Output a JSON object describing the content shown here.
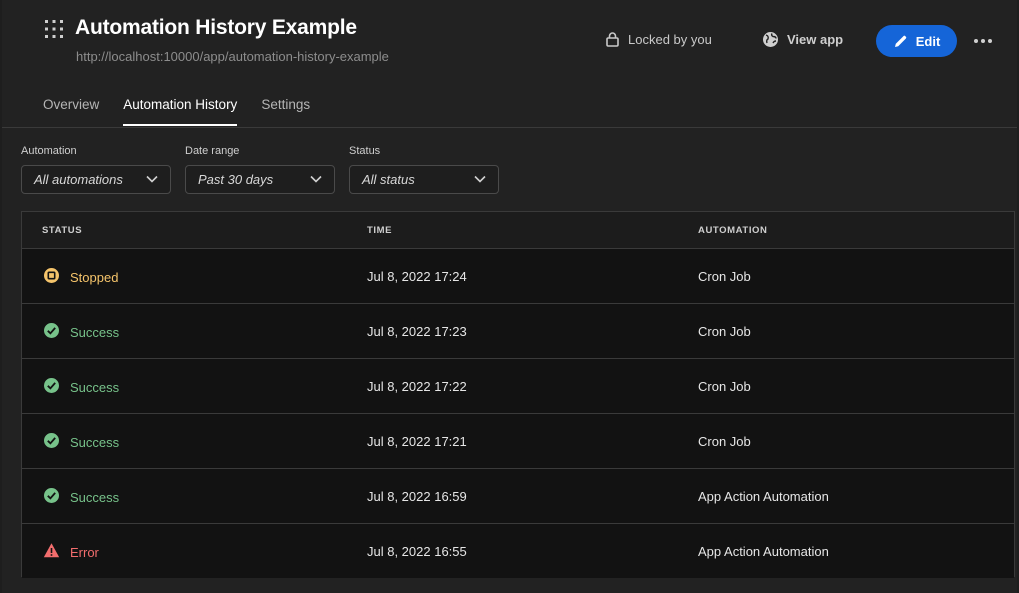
{
  "header": {
    "title": "Automation History Example",
    "url": "http://localhost:10000/app/automation-history-example",
    "locked_text": "Locked by you",
    "view_app_label": "View app",
    "edit_label": "Edit"
  },
  "tabs": [
    {
      "label": "Overview",
      "active": false
    },
    {
      "label": "Automation History",
      "active": true
    },
    {
      "label": "Settings",
      "active": false
    }
  ],
  "filters": {
    "automation": {
      "label": "Automation",
      "value": "All automations"
    },
    "date_range": {
      "label": "Date range",
      "value": "Past 30 days"
    },
    "status": {
      "label": "Status",
      "value": "All status"
    }
  },
  "table": {
    "columns": [
      "STATUS",
      "TIME",
      "AUTOMATION"
    ],
    "rows": [
      {
        "status": "Stopped",
        "time": "Jul 8, 2022 17:24",
        "automation": "Cron Job"
      },
      {
        "status": "Success",
        "time": "Jul 8, 2022 17:23",
        "automation": "Cron Job"
      },
      {
        "status": "Success",
        "time": "Jul 8, 2022 17:22",
        "automation": "Cron Job"
      },
      {
        "status": "Success",
        "time": "Jul 8, 2022 17:21",
        "automation": "Cron Job"
      },
      {
        "status": "Success",
        "time": "Jul 8, 2022 16:59",
        "automation": "App Action Automation"
      },
      {
        "status": "Error",
        "time": "Jul 8, 2022 16:55",
        "automation": "App Action Automation"
      }
    ]
  },
  "colors": {
    "stopped": "#f5c46b",
    "success": "#77c28a",
    "error": "#f26d6d",
    "accent": "#1565d8"
  },
  "icons": {
    "stopped": "stop-circle-icon",
    "success": "check-circle-icon",
    "error": "warning-triangle-icon"
  }
}
